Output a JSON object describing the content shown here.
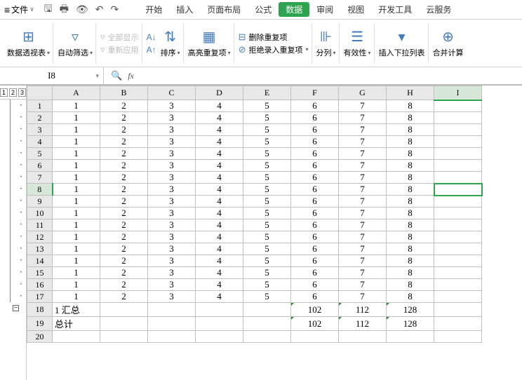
{
  "titlebar": {
    "file_label": "文件",
    "tabs": [
      "开始",
      "插入",
      "页面布局",
      "公式",
      "数据",
      "审阅",
      "视图",
      "开发工具",
      "云服务"
    ],
    "active_tab_index": 4
  },
  "ribbon": {
    "pivot": {
      "label": "数据透视表"
    },
    "autofilter": {
      "label": "自动筛选"
    },
    "show_all": {
      "label": "全部显示"
    },
    "reapply": {
      "label": "重新应用"
    },
    "sort": {
      "label": "排序"
    },
    "highlight_dup": {
      "label": "高亮重复项"
    },
    "remove_dup": {
      "label": "删除重复项"
    },
    "reject_dup": {
      "label": "拒绝录入重复项"
    },
    "text_to_cols": {
      "label": "分列"
    },
    "validation": {
      "label": "有效性"
    },
    "insert_dropdown": {
      "label": "插入下拉列表"
    },
    "consolidate": {
      "label": "合并计算"
    }
  },
  "namebox": {
    "value": "I8",
    "fx_label": "fx"
  },
  "outline": {
    "levels": [
      "1",
      "2",
      "3"
    ]
  },
  "columns": [
    "A",
    "B",
    "C",
    "D",
    "E",
    "F",
    "G",
    "H",
    "I"
  ],
  "active_col": "I",
  "active_row": 8,
  "chart_data": {
    "type": "table",
    "rows": [
      {
        "r": 1,
        "cells": [
          "1",
          "2",
          "3",
          "4",
          "5",
          "6",
          "7",
          "8",
          ""
        ]
      },
      {
        "r": 2,
        "cells": [
          "1",
          "2",
          "3",
          "4",
          "5",
          "6",
          "7",
          "8",
          ""
        ]
      },
      {
        "r": 3,
        "cells": [
          "1",
          "2",
          "3",
          "4",
          "5",
          "6",
          "7",
          "8",
          ""
        ]
      },
      {
        "r": 4,
        "cells": [
          "1",
          "2",
          "3",
          "4",
          "5",
          "6",
          "7",
          "8",
          ""
        ]
      },
      {
        "r": 5,
        "cells": [
          "1",
          "2",
          "3",
          "4",
          "5",
          "6",
          "7",
          "8",
          ""
        ]
      },
      {
        "r": 6,
        "cells": [
          "1",
          "2",
          "3",
          "4",
          "5",
          "6",
          "7",
          "8",
          ""
        ]
      },
      {
        "r": 7,
        "cells": [
          "1",
          "2",
          "3",
          "4",
          "5",
          "6",
          "7",
          "8",
          ""
        ]
      },
      {
        "r": 8,
        "cells": [
          "1",
          "2",
          "3",
          "4",
          "5",
          "6",
          "7",
          "8",
          ""
        ]
      },
      {
        "r": 9,
        "cells": [
          "1",
          "2",
          "3",
          "4",
          "5",
          "6",
          "7",
          "8",
          ""
        ]
      },
      {
        "r": 10,
        "cells": [
          "1",
          "2",
          "3",
          "4",
          "5",
          "6",
          "7",
          "8",
          ""
        ]
      },
      {
        "r": 11,
        "cells": [
          "1",
          "2",
          "3",
          "4",
          "5",
          "6",
          "7",
          "8",
          ""
        ]
      },
      {
        "r": 12,
        "cells": [
          "1",
          "2",
          "3",
          "4",
          "5",
          "6",
          "7",
          "8",
          ""
        ]
      },
      {
        "r": 13,
        "cells": [
          "1",
          "2",
          "3",
          "4",
          "5",
          "6",
          "7",
          "8",
          ""
        ]
      },
      {
        "r": 14,
        "cells": [
          "1",
          "2",
          "3",
          "4",
          "5",
          "6",
          "7",
          "8",
          ""
        ]
      },
      {
        "r": 15,
        "cells": [
          "1",
          "2",
          "3",
          "4",
          "5",
          "6",
          "7",
          "8",
          ""
        ]
      },
      {
        "r": 16,
        "cells": [
          "1",
          "2",
          "3",
          "4",
          "5",
          "6",
          "7",
          "8",
          ""
        ]
      },
      {
        "r": 17,
        "cells": [
          "1",
          "2",
          "3",
          "4",
          "5",
          "6",
          "7",
          "8",
          ""
        ]
      },
      {
        "r": 18,
        "cells": [
          "1 汇总",
          "",
          "",
          "",
          "",
          "102",
          "112",
          "128",
          ""
        ],
        "ltxt0": true,
        "tri": [
          5,
          6,
          7
        ]
      },
      {
        "r": 19,
        "cells": [
          "总计",
          "",
          "",
          "",
          "",
          "102",
          "112",
          "128",
          ""
        ],
        "ltxt0": true,
        "tri": [
          5,
          6,
          7
        ]
      },
      {
        "r": 20,
        "cells": [
          "",
          "",
          "",
          "",
          "",
          "",
          "",
          "",
          ""
        ]
      }
    ]
  }
}
